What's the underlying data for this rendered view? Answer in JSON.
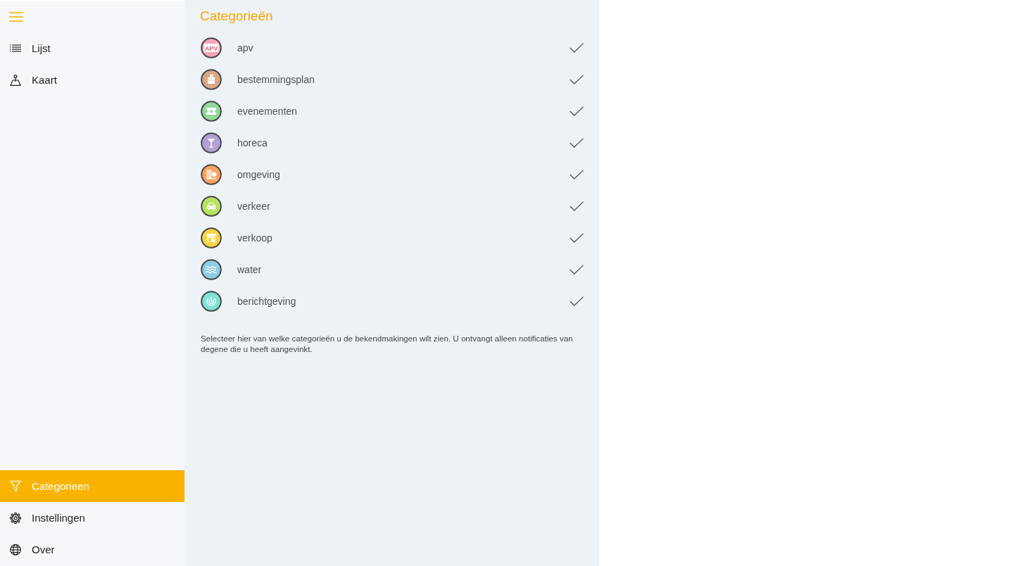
{
  "sidebar": {
    "top_items": [
      {
        "label": "Lijst",
        "kind": "list",
        "selected": false
      },
      {
        "label": "Kaart",
        "kind": "pin",
        "selected": false
      }
    ],
    "bottom_items": [
      {
        "label": "Categorieen",
        "kind": "filter",
        "selected": true
      },
      {
        "label": "Instellingen",
        "kind": "gear",
        "selected": false
      },
      {
        "label": "Over",
        "kind": "globe",
        "selected": false
      }
    ]
  },
  "page": {
    "title": "Categorieën",
    "categories": [
      {
        "name": "apv",
        "kind": "apv",
        "icon_text": "APV",
        "color": "#f7a3b8",
        "checked": true
      },
      {
        "name": "bestemmingsplan",
        "kind": "building",
        "color": "#d9a887",
        "checked": true
      },
      {
        "name": "evenementen",
        "kind": "ticket",
        "color": "#8fd99a",
        "checked": true
      },
      {
        "name": "horeca",
        "kind": "glass",
        "color": "#b49fd6",
        "checked": true
      },
      {
        "name": "omgeving",
        "kind": "city",
        "color": "#fba25e",
        "checked": true
      },
      {
        "name": "verkeer",
        "kind": "car",
        "color": "#b8e35f",
        "checked": true
      },
      {
        "name": "verkoop",
        "kind": "shop",
        "color": "#f8d543",
        "checked": true
      },
      {
        "name": "water",
        "kind": "waves",
        "color": "#8fcfe6",
        "checked": true
      },
      {
        "name": "berichtgeving",
        "kind": "signal",
        "color": "#7fe3d4",
        "checked": true
      }
    ],
    "description": "Selecteer hier van welke categorieën u de bekendmakingen wilt zien. U ontvangt alleen notificaties van degene die u heeft aangevinkt."
  }
}
